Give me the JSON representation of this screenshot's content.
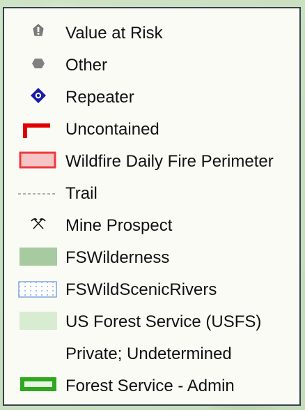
{
  "legend": {
    "items": [
      {
        "label": "Value at Risk",
        "icon": "value-at-risk-icon"
      },
      {
        "label": "Other",
        "icon": "other-hexagon-icon"
      },
      {
        "label": "Repeater",
        "icon": "repeater-icon",
        "color": "#1a1aa8"
      },
      {
        "label": "Uncontained",
        "icon": "uncontained-line-icon",
        "color": "#e00000"
      },
      {
        "label": "Wildfire Daily Fire Perimeter",
        "icon": "fire-perimeter-icon",
        "color": "#ee3a3a"
      },
      {
        "label": "Trail",
        "icon": "trail-dashed-line-icon"
      },
      {
        "label": "Mine Prospect",
        "icon": "mine-prospect-icon"
      },
      {
        "label": "FSWilderness",
        "icon": "wilderness-fill-icon",
        "color": "#a8caa0"
      },
      {
        "label": "FSWildScenicRivers",
        "icon": "wild-scenic-rivers-icon",
        "color": "#5b8fd6"
      },
      {
        "label": "US Forest Service (USFS)",
        "icon": "usfs-fill-icon",
        "color": "#d8ecd2"
      },
      {
        "label": "Private; Undetermined",
        "icon": "private-undetermined-icon"
      },
      {
        "label": "Forest Service - Admin",
        "icon": "forest-service-admin-icon",
        "color": "#2ea81e"
      }
    ]
  }
}
